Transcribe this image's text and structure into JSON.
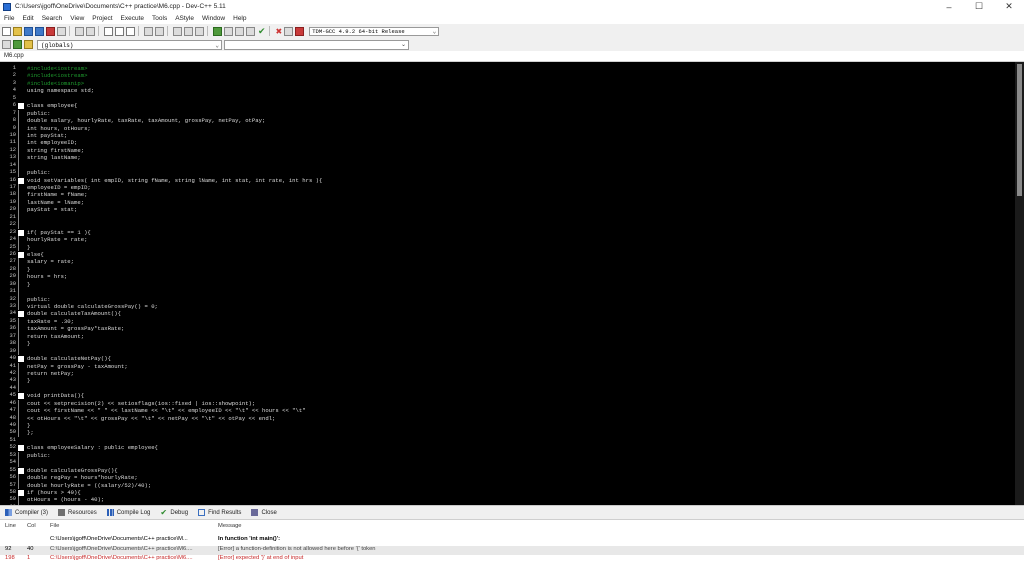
{
  "window": {
    "title": "C:\\Users\\jgoff\\OneDrive\\Documents\\C++ practice\\M6.cpp - Dev-C++ 5.11",
    "controls": [
      "–",
      "☐",
      "✕"
    ]
  },
  "menu": [
    "File",
    "Edit",
    "Search",
    "View",
    "Project",
    "Execute",
    "Tools",
    "AStyle",
    "Window",
    "Help"
  ],
  "toolbar": {
    "compiler": "TDM-GCC 4.9.2 64-bit Release",
    "scope": "(globals)"
  },
  "file_tab": "M6.cpp",
  "editor_lines": [
    {
      "n": "1",
      "t": "#include<iostream>",
      "c": true,
      "f": ""
    },
    {
      "n": "2",
      "t": "#include<iostream>",
      "c": true,
      "f": ""
    },
    {
      "n": "3",
      "t": "#include<iomanip>",
      "c": true,
      "f": ""
    },
    {
      "n": "4",
      "t": "using namespace std;",
      "c": false,
      "f": ""
    },
    {
      "n": "5",
      "t": "",
      "c": false,
      "f": ""
    },
    {
      "n": "6",
      "t": "class employee{",
      "c": false,
      "f": "box"
    },
    {
      "n": "7",
      "t": "public:",
      "c": false,
      "f": "tick"
    },
    {
      "n": "8",
      "t": "double salary, hourlyRate, taxRate, taxAmount, grossPay, netPay, otPay;",
      "c": false,
      "f": "tick"
    },
    {
      "n": "9",
      "t": "int hours, otHours;",
      "c": false,
      "f": "tick"
    },
    {
      "n": "10",
      "t": "int payStat;",
      "c": false,
      "f": "tick"
    },
    {
      "n": "11",
      "t": "int employeeID;",
      "c": false,
      "f": "tick"
    },
    {
      "n": "12",
      "t": "string firstName;",
      "c": false,
      "f": "tick"
    },
    {
      "n": "13",
      "t": "string lastName;",
      "c": false,
      "f": "tick"
    },
    {
      "n": "14",
      "t": "",
      "c": false,
      "f": "tick"
    },
    {
      "n": "15",
      "t": "public:",
      "c": false,
      "f": "tick"
    },
    {
      "n": "16",
      "t": "void setVariables( int empID, string fName, string lName, int stat, int rate, int hrs ){",
      "c": false,
      "f": "box"
    },
    {
      "n": "17",
      "t": "employeeID = empID;",
      "c": false,
      "f": "tick"
    },
    {
      "n": "18",
      "t": "firstName = fName;",
      "c": false,
      "f": "tick"
    },
    {
      "n": "19",
      "t": "lastName = lName;",
      "c": false,
      "f": "tick"
    },
    {
      "n": "20",
      "t": "payStat = stat;",
      "c": false,
      "f": "tick"
    },
    {
      "n": "21",
      "t": "",
      "c": false,
      "f": "tick"
    },
    {
      "n": "22",
      "t": "",
      "c": false,
      "f": "tick"
    },
    {
      "n": "23",
      "t": "if( payStat == 1 ){",
      "c": false,
      "f": "box"
    },
    {
      "n": "24",
      "t": "hourlyRate = rate;",
      "c": false,
      "f": "tick"
    },
    {
      "n": "25",
      "t": "}",
      "c": false,
      "f": "tick"
    },
    {
      "n": "26",
      "t": "else{",
      "c": false,
      "f": "box"
    },
    {
      "n": "27",
      "t": "salary = rate;",
      "c": false,
      "f": "tick"
    },
    {
      "n": "28",
      "t": "}",
      "c": false,
      "f": "tick"
    },
    {
      "n": "29",
      "t": "hours = hrs;",
      "c": false,
      "f": "tick"
    },
    {
      "n": "30",
      "t": "}",
      "c": false,
      "f": "tick"
    },
    {
      "n": "31",
      "t": "",
      "c": false,
      "f": "tick"
    },
    {
      "n": "32",
      "t": "public:",
      "c": false,
      "f": "tick"
    },
    {
      "n": "33",
      "t": "virtual double calculateGrossPay() = 0;",
      "c": false,
      "f": "tick"
    },
    {
      "n": "34",
      "t": "double calculateTaxAmount(){",
      "c": false,
      "f": "box"
    },
    {
      "n": "35",
      "t": "taxRate = .30;",
      "c": false,
      "f": "tick"
    },
    {
      "n": "36",
      "t": "taxAmount = grossPay*taxRate;",
      "c": false,
      "f": "tick"
    },
    {
      "n": "37",
      "t": "return taxAmount;",
      "c": false,
      "f": "tick"
    },
    {
      "n": "38",
      "t": "}",
      "c": false,
      "f": "tick"
    },
    {
      "n": "39",
      "t": "",
      "c": false,
      "f": "tick"
    },
    {
      "n": "40",
      "t": "double calculateNetPay(){",
      "c": false,
      "f": "box"
    },
    {
      "n": "41",
      "t": "netPay = grossPay - taxAmount;",
      "c": false,
      "f": "tick"
    },
    {
      "n": "42",
      "t": "return netPay;",
      "c": false,
      "f": "tick"
    },
    {
      "n": "43",
      "t": "}",
      "c": false,
      "f": "tick"
    },
    {
      "n": "44",
      "t": "",
      "c": false,
      "f": "tick"
    },
    {
      "n": "45",
      "t": "void printData(){",
      "c": false,
      "f": "box"
    },
    {
      "n": "46",
      "t": "cout << setprecision(2) << setiosflags(ios::fixed | ios::showpoint);",
      "c": false,
      "f": "tick"
    },
    {
      "n": "47",
      "t": "cout << firstName << \" \" << lastName << \"\\t\" << employeeID << \"\\t\" << hours << \"\\t\"",
      "c": false,
      "f": "tick"
    },
    {
      "n": "48",
      "t": "<< otHours << \"\\t\" << grossPay << \"\\t\" << netPay << \"\\t\" << otPay << endl;",
      "c": false,
      "f": "tick"
    },
    {
      "n": "49",
      "t": "}",
      "c": false,
      "f": "tick"
    },
    {
      "n": "50",
      "t": "};",
      "c": false,
      "f": "tick"
    },
    {
      "n": "51",
      "t": "",
      "c": false,
      "f": ""
    },
    {
      "n": "52",
      "t": "class employeeSalary : public employee{",
      "c": false,
      "f": "box"
    },
    {
      "n": "53",
      "t": "public:",
      "c": false,
      "f": "tick"
    },
    {
      "n": "54",
      "t": "",
      "c": false,
      "f": "tick"
    },
    {
      "n": "55",
      "t": "double calculateGrossPay(){",
      "c": false,
      "f": "box"
    },
    {
      "n": "56",
      "t": "double regPay = hours*hourlyRate;",
      "c": false,
      "f": "tick"
    },
    {
      "n": "57",
      "t": "double hourlyRate = ((salary/52)/40);",
      "c": false,
      "f": "tick"
    },
    {
      "n": "58",
      "t": "if (hours > 40){",
      "c": false,
      "f": "box"
    },
    {
      "n": "59",
      "t": "otHours = (hours - 40);",
      "c": false,
      "f": "tick"
    },
    {
      "n": "60",
      "t": "otPay = (otHours * hourlyRate);",
      "c": false,
      "f": "tick"
    }
  ],
  "bottom_tabs": [
    {
      "label": "Compiler (3)",
      "icon": "compiler-grid-icon",
      "cls": "grid"
    },
    {
      "label": "Resources",
      "icon": "resources-icon",
      "cls": "res"
    },
    {
      "label": "Compile Log",
      "icon": "compile-log-icon",
      "cls": "bars"
    },
    {
      "label": "Debug",
      "icon": "debug-check-icon",
      "cls": "check"
    },
    {
      "label": "Find Results",
      "icon": "find-results-icon",
      "cls": "find"
    },
    {
      "label": "Close",
      "icon": "close-panel-icon",
      "cls": "close"
    }
  ],
  "messages": {
    "headers": {
      "line": "Line",
      "col": "Col",
      "file": "File",
      "message": "Message"
    },
    "rows": [
      {
        "line": "",
        "col": "",
        "file": "C:\\Users\\jgoff\\OneDrive\\Documents\\C++ practice\\M...",
        "message": "In function 'int main()':"
      },
      {
        "line": "92",
        "col": "40",
        "file": "C:\\Users\\jgoff\\OneDrive\\Documents\\C++ practice\\M6....",
        "message": "[Error] a function-definition is not allowed here before '{' token"
      },
      {
        "line": "198",
        "col": "1",
        "file": "C:\\Users\\jgoff\\OneDrive\\Documents\\C++ practice\\M6....",
        "message": "[Error] expected '}' at end of input"
      }
    ]
  }
}
